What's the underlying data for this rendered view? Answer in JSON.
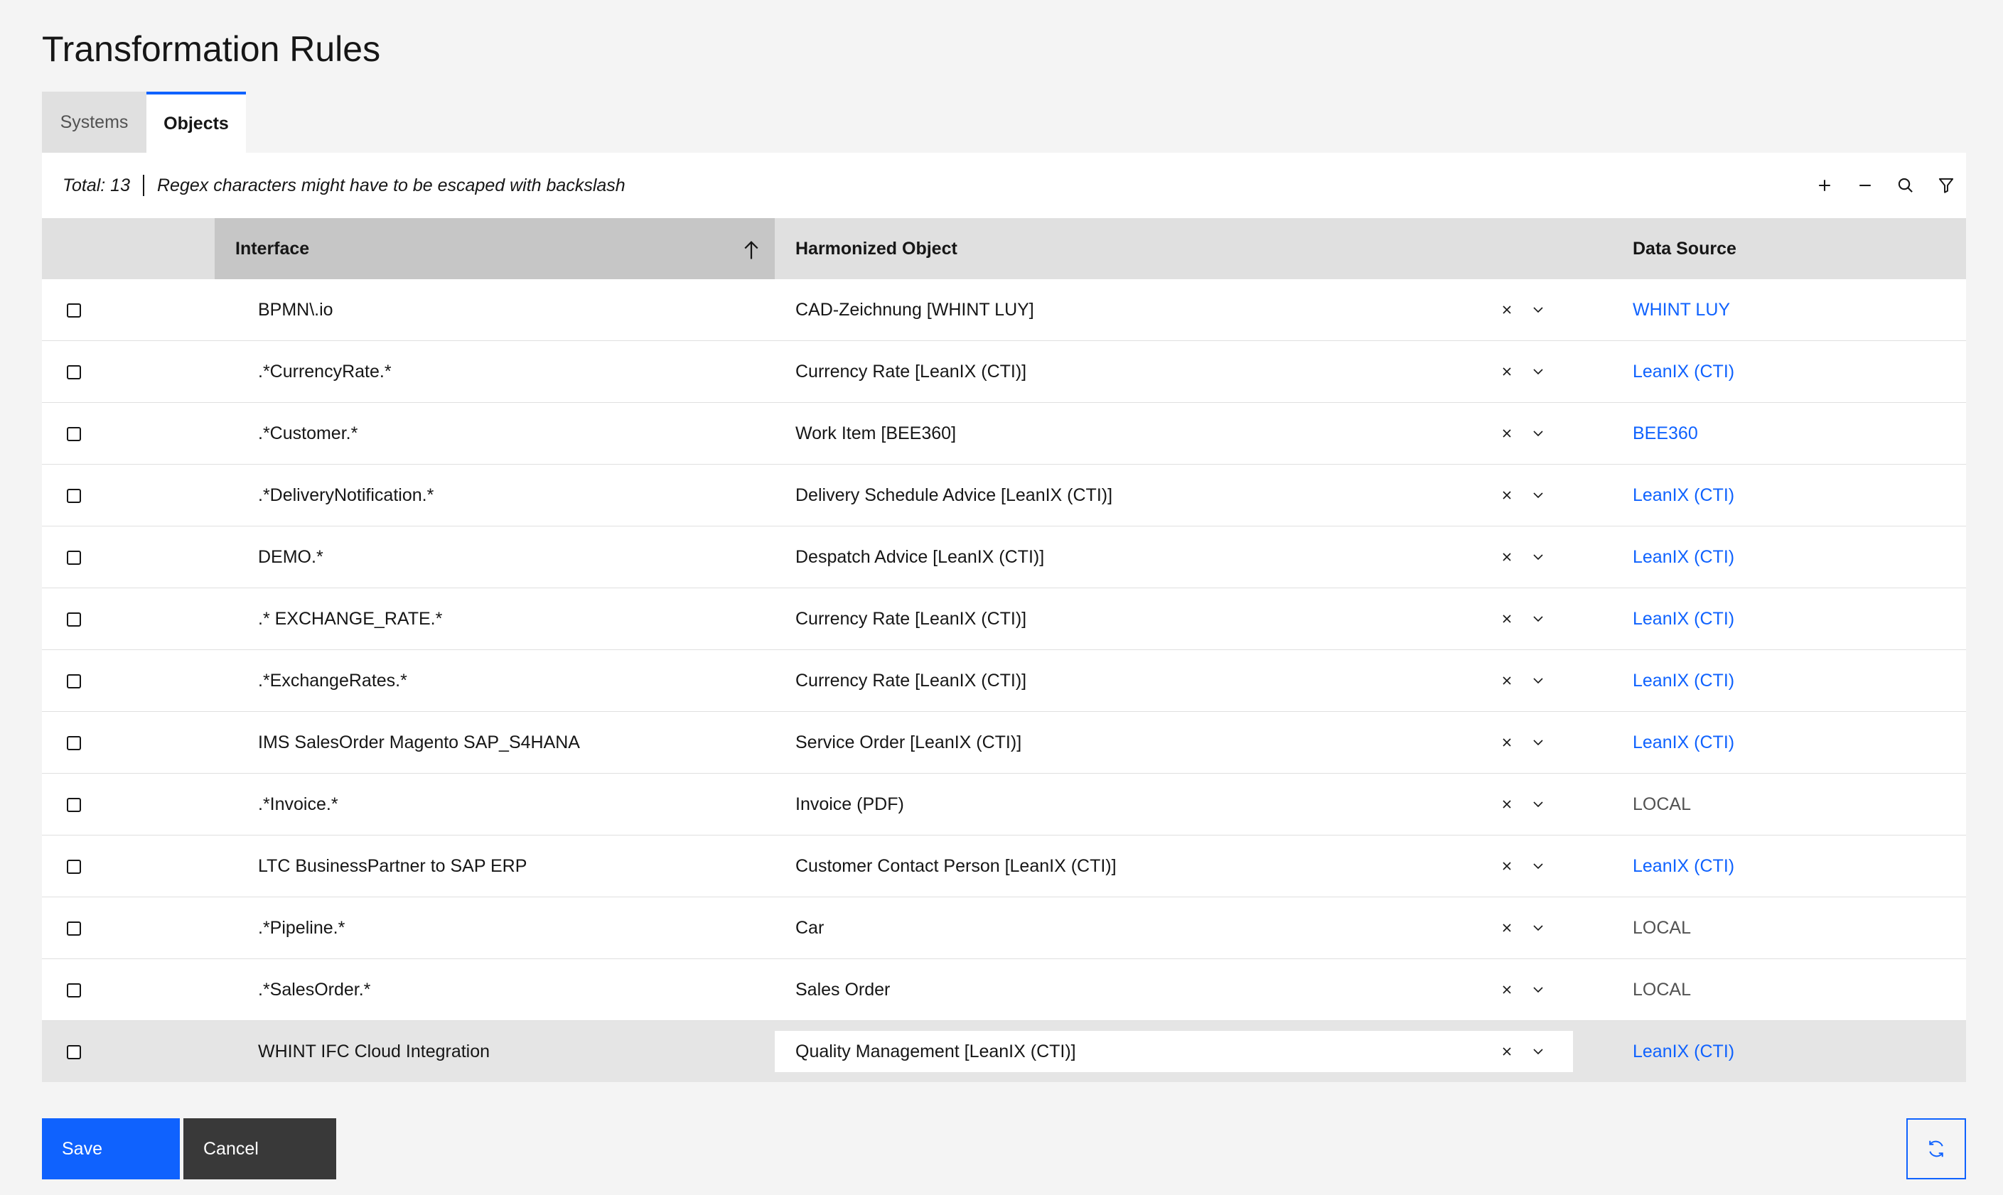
{
  "page": {
    "title": "Transformation Rules"
  },
  "tabs": [
    {
      "label": "Systems",
      "active": false
    },
    {
      "label": "Objects",
      "active": true
    }
  ],
  "toolbar": {
    "total": "Total: 13",
    "hint": "Regex characters might have to be escaped with backslash",
    "icons": [
      "plus-icon",
      "minus-icon",
      "search-icon",
      "filter-icon"
    ]
  },
  "table": {
    "columns": [
      "Interface",
      "Harmonized Object",
      "Data Source"
    ],
    "sorted_column": "Interface",
    "sort_direction": "ascending",
    "rows": [
      {
        "interface": "BPMN\\.io",
        "harmonized": "CAD-Zeichnung [WHINT LUY]",
        "source": "WHINT LUY",
        "source_link": true
      },
      {
        "interface": ".*CurrencyRate.*",
        "harmonized": "Currency Rate [LeanIX (CTI)]",
        "source": "LeanIX (CTI)",
        "source_link": true
      },
      {
        "interface": ".*Customer.*",
        "harmonized": "Work Item [BEE360]",
        "source": "BEE360",
        "source_link": true
      },
      {
        "interface": ".*DeliveryNotification.*",
        "harmonized": "Delivery Schedule Advice [LeanIX (CTI)]",
        "source": "LeanIX (CTI)",
        "source_link": true
      },
      {
        "interface": "DEMO.*",
        "harmonized": "Despatch Advice [LeanIX (CTI)]",
        "source": "LeanIX (CTI)",
        "source_link": true
      },
      {
        "interface": ".* EXCHANGE_RATE.*",
        "harmonized": "Currency Rate [LeanIX (CTI)]",
        "source": "LeanIX (CTI)",
        "source_link": true
      },
      {
        "interface": ".*ExchangeRates.*",
        "harmonized": "Currency Rate [LeanIX (CTI)]",
        "source": "LeanIX (CTI)",
        "source_link": true
      },
      {
        "interface": "IMS SalesOrder Magento SAP_S4HANA",
        "harmonized": "Service Order [LeanIX (CTI)]",
        "source": "LeanIX (CTI)",
        "source_link": true
      },
      {
        "interface": ".*Invoice.*",
        "harmonized": "Invoice (PDF)",
        "source": "LOCAL",
        "source_link": false
      },
      {
        "interface": "LTC BusinessPartner to SAP ERP",
        "harmonized": "Customer Contact Person [LeanIX (CTI)]",
        "source": "LeanIX (CTI)",
        "source_link": true
      },
      {
        "interface": ".*Pipeline.*",
        "harmonized": "Car",
        "source": "LOCAL",
        "source_link": false
      },
      {
        "interface": ".*SalesOrder.*",
        "harmonized": "Sales Order",
        "source": "LOCAL",
        "source_link": false
      },
      {
        "interface": "WHINT IFC Cloud Integration",
        "harmonized": "Quality Management [LeanIX (CTI)]",
        "source": "LeanIX (CTI)",
        "source_link": true,
        "selected": true
      }
    ]
  },
  "actions": {
    "save_label": "Save",
    "cancel_label": "Cancel",
    "refresh_icon": "refresh-icon"
  },
  "colors": {
    "accent": "#0f62fe",
    "background": "#f4f4f4",
    "header": "#e0e0e0",
    "sorted_header": "#c6c6c6",
    "secondary_button": "#393939"
  }
}
